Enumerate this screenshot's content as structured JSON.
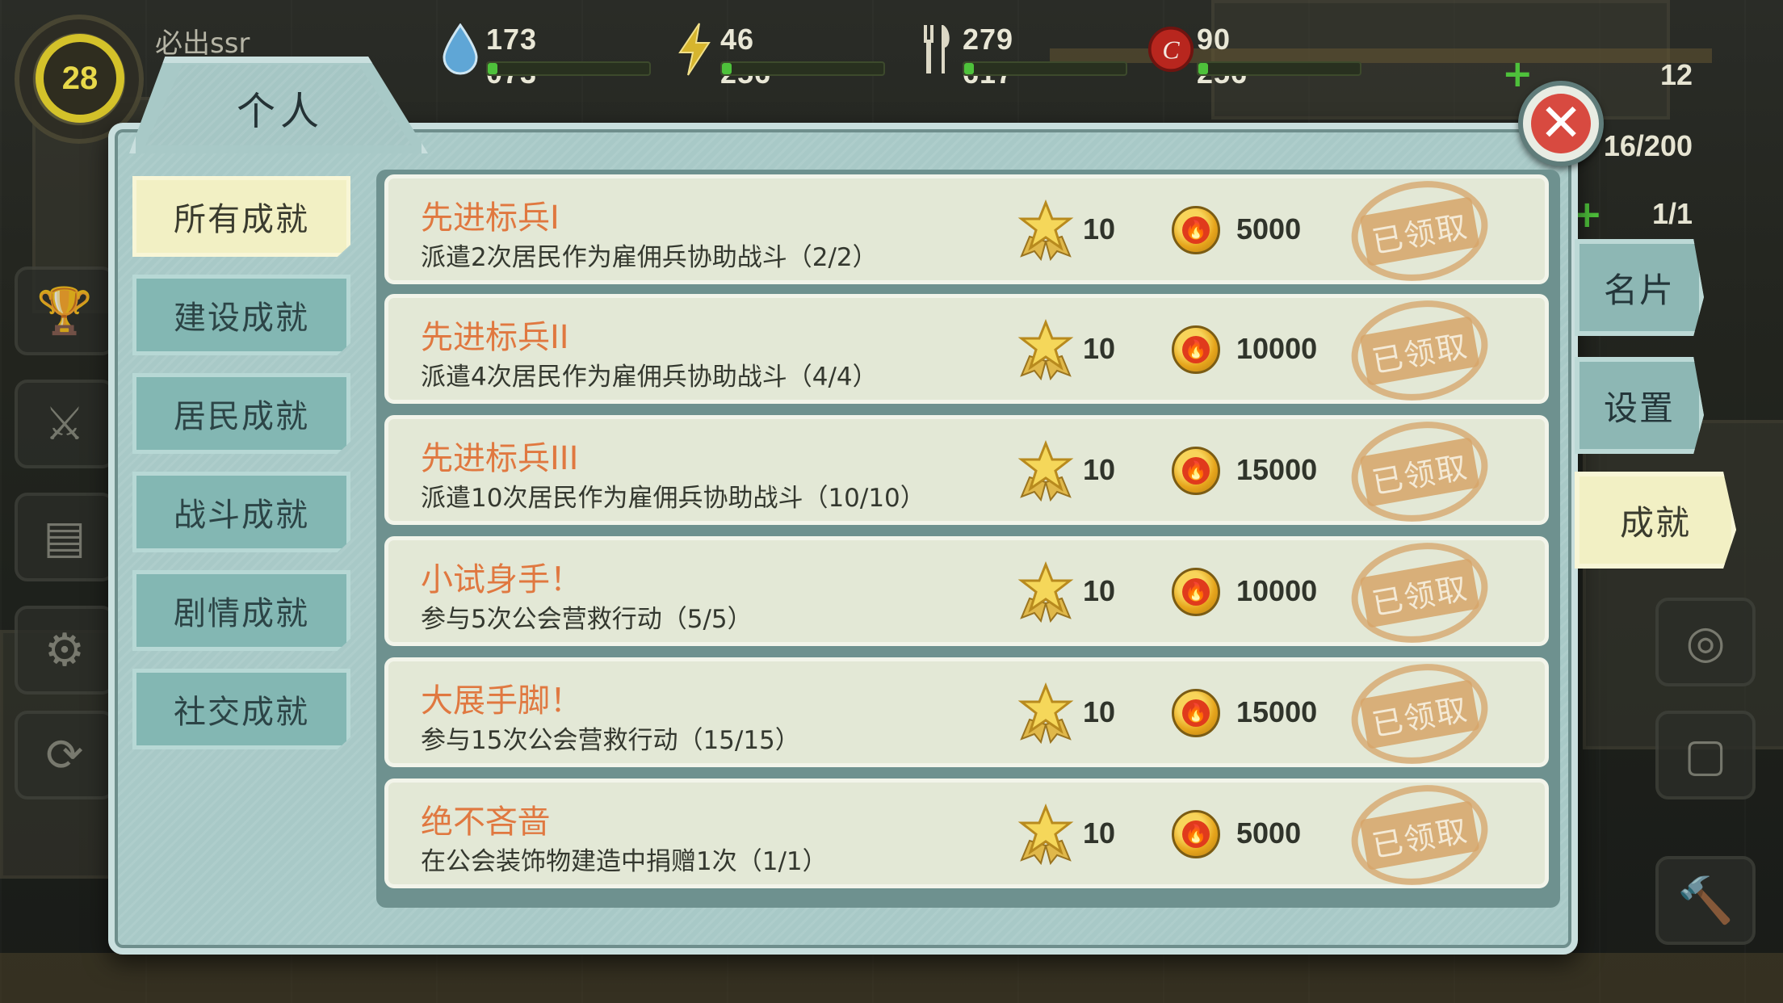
{
  "hud": {
    "level": "28",
    "player_name": "必出ssr",
    "water": "173 073",
    "power": "46 256",
    "food": "279 617",
    "caps": "90 256",
    "nuka": "12",
    "stimpak": "16/200",
    "tools": "1/1",
    "icons": {
      "water": "water-drop-icon",
      "power": "lightning-icon",
      "food": "fork-knife-icon",
      "caps": "bottle-cap-icon"
    }
  },
  "dialog": {
    "title": "个人",
    "close_icon": "close-icon",
    "categories": [
      {
        "label": "所有成就",
        "active": true
      },
      {
        "label": "建设成就",
        "active": false
      },
      {
        "label": "居民成就",
        "active": false
      },
      {
        "label": "战斗成就",
        "active": false
      },
      {
        "label": "剧情成就",
        "active": false
      },
      {
        "label": "社交成就",
        "active": false
      }
    ],
    "right_tabs": [
      {
        "label": "名片",
        "active": false
      },
      {
        "label": "设置",
        "active": false
      },
      {
        "label": "成就",
        "active": true
      }
    ],
    "achievements": [
      {
        "title": "先进标兵I",
        "desc": "派遣2次居民作为雇佣兵协助战斗（2/2）",
        "points": "10",
        "coins": "5000",
        "status": "已领取"
      },
      {
        "title": "先进标兵II",
        "desc": "派遣4次居民作为雇佣兵协助战斗（4/4）",
        "points": "10",
        "coins": "10000",
        "status": "已领取"
      },
      {
        "title": "先进标兵III",
        "desc": "派遣10次居民作为雇佣兵协助战斗（10/10）",
        "points": "10",
        "coins": "15000",
        "status": "已领取"
      },
      {
        "title": "小试身手！",
        "desc": "参与5次公会营救行动（5/5）",
        "points": "10",
        "coins": "10000",
        "status": "已领取"
      },
      {
        "title": "大展手脚！",
        "desc": "参与15次公会营救行动（15/15）",
        "points": "10",
        "coins": "15000",
        "status": "已领取"
      },
      {
        "title": "绝不吝啬",
        "desc": "在公会装饰物建造中捐赠1次（1/1）",
        "points": "10",
        "coins": "5000",
        "status": "已领取"
      }
    ]
  },
  "colors": {
    "dialog_bg": "#a8c9c7",
    "tab_active": "#f2f0c4",
    "title_orange": "#e07840",
    "close_red": "#d84a40",
    "stamp": "#d6a468"
  }
}
